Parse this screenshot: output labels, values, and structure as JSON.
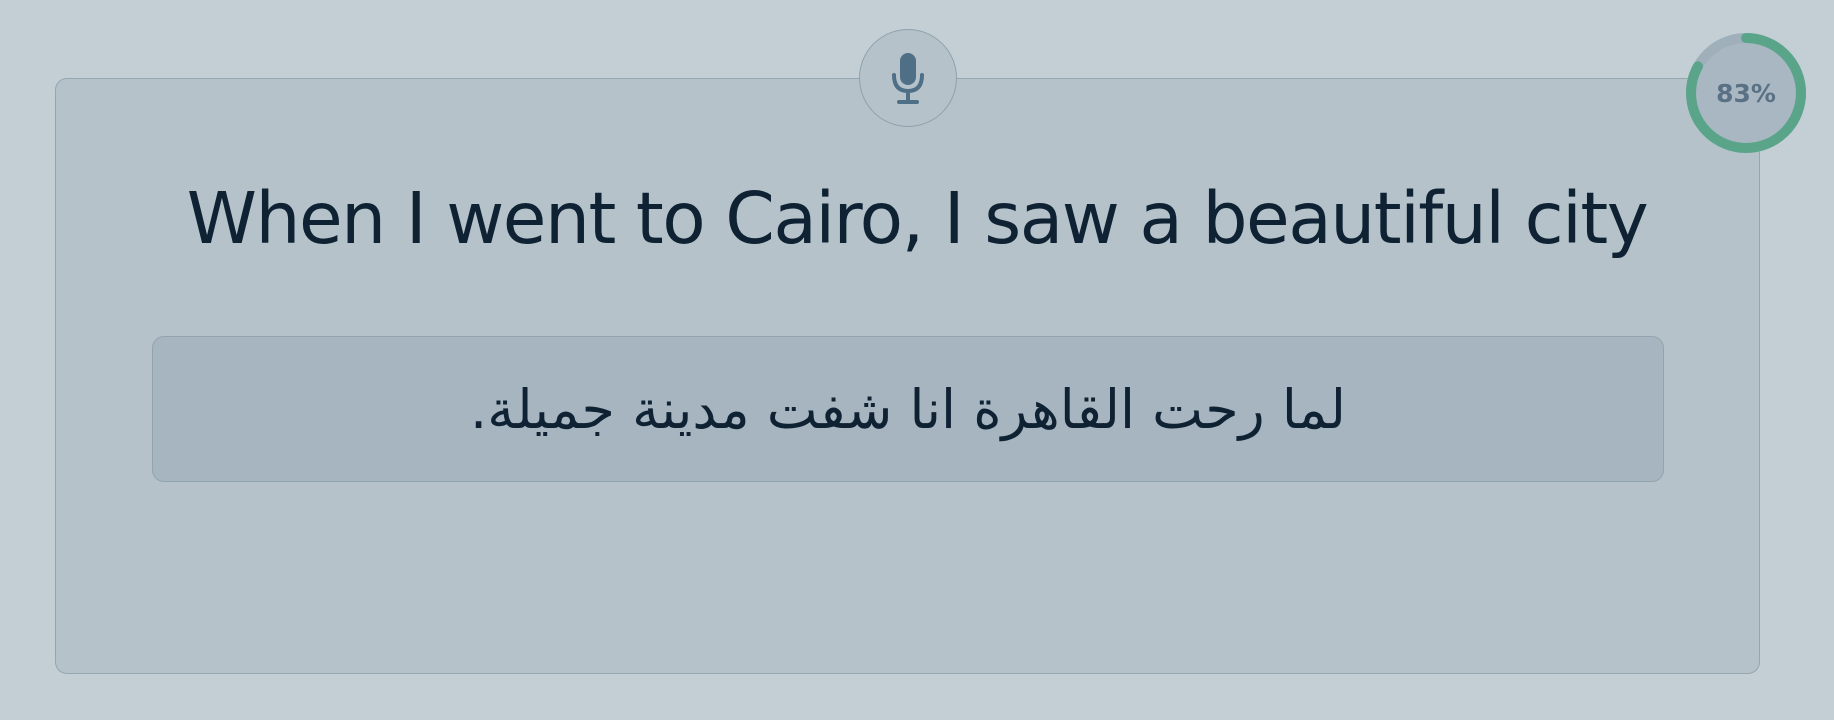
{
  "prompt": {
    "text": "When I went to Cairo, I saw a beautiful city"
  },
  "answer": {
    "text": "لما رحت القاهرة انا شفت مدينة جميلة."
  },
  "mic": {
    "icon": "microphone-icon"
  },
  "progress": {
    "value": 83,
    "label": "83%"
  },
  "colors": {
    "background": "#c4ced5",
    "card": "#b5c2ca",
    "answer_box": "#a6b5bf",
    "text": "#0f2233",
    "progress_fill": "#5aa58a",
    "progress_track": "#9fb0bb",
    "icon": "#4f6f86"
  }
}
